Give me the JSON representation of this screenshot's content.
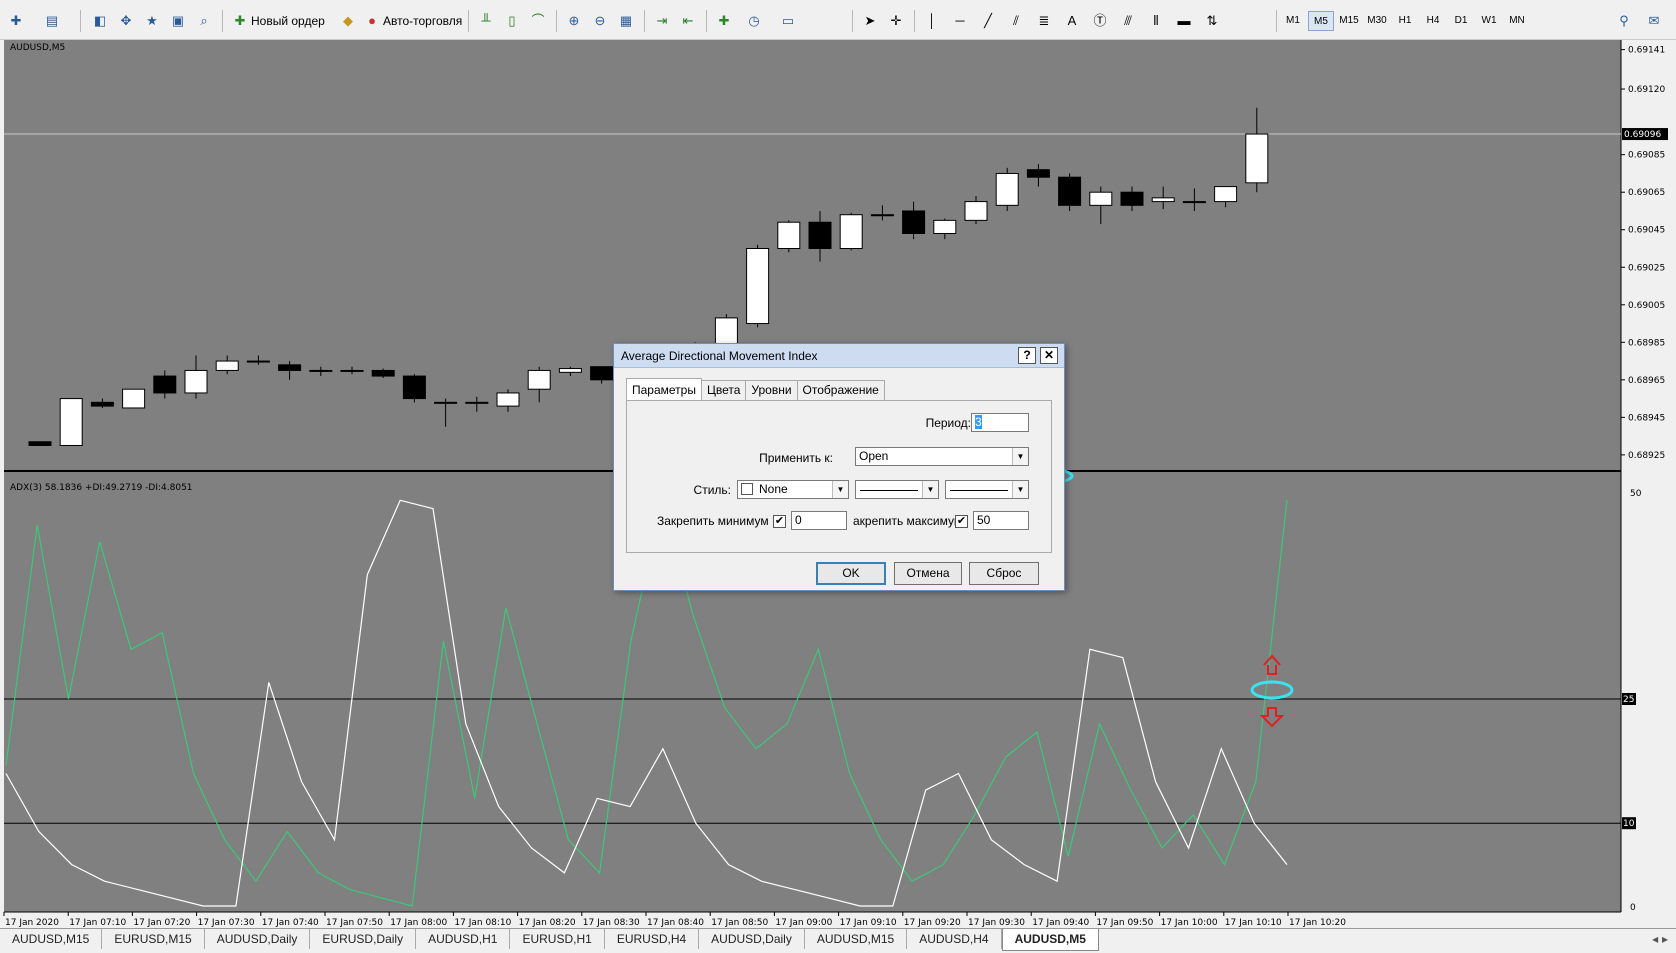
{
  "toolbar": {
    "new_order": "Новый ордер",
    "auto_trading": "Авто-торговля",
    "timeframes": [
      "M1",
      "M5",
      "M15",
      "M30",
      "H1",
      "H4",
      "D1",
      "W1",
      "MN"
    ],
    "active_timeframe": "M5"
  },
  "chart": {
    "symbol_label": "AUDUSD,M5",
    "price_ticks": [
      "0.69141",
      "0.69120",
      "0.69085",
      "0.69065",
      "0.69045",
      "0.69025",
      "0.69005",
      "0.68985",
      "0.68965",
      "0.68945",
      "0.68925"
    ],
    "current_price": "0.69096",
    "indicator_label": "ADX(3) 58.1836 +DI:49.2719 -DI:4.8051",
    "indicator_ticks": [
      "50",
      "25",
      "10",
      "0"
    ],
    "time_labels": [
      "17 Jan 2020",
      "17 Jan 07:10",
      "17 Jan 07:20",
      "17 Jan 07:30",
      "17 Jan 07:40",
      "17 Jan 07:50",
      "17 Jan 08:00",
      "17 Jan 08:10",
      "17 Jan 08:20",
      "17 Jan 08:30",
      "17 Jan 08:40",
      "17 Jan 08:50",
      "17 Jan 09:00",
      "17 Jan 09:10",
      "17 Jan 09:20",
      "17 Jan 09:30",
      "17 Jan 09:40",
      "17 Jan 09:50",
      "17 Jan 10:00",
      "17 Jan 10:10",
      "17 Jan 10:20"
    ],
    "colors": {
      "background": "#808080",
      "bull": "#ffffff",
      "bear": "#000000",
      "adx": "#ffffff",
      "plus_di": "#3cc878",
      "level": "#000000",
      "annotation_circle": "#39e4f0",
      "annotation_arrow": "#e02020"
    }
  },
  "chart_data": {
    "type": "candlestick",
    "candles": [
      [
        0.68932,
        0.68932,
        0.6893,
        0.6893
      ],
      [
        0.6893,
        0.68955,
        0.6893,
        0.68955
      ],
      [
        0.68953,
        0.68955,
        0.6895,
        0.68951
      ],
      [
        0.6895,
        0.6896,
        0.6895,
        0.6896
      ],
      [
        0.68967,
        0.6897,
        0.68955,
        0.68958
      ],
      [
        0.68958,
        0.68978,
        0.68955,
        0.6897
      ],
      [
        0.6897,
        0.68978,
        0.68968,
        0.68975
      ],
      [
        0.68975,
        0.68978,
        0.68973,
        0.68975
      ],
      [
        0.68973,
        0.68975,
        0.68965,
        0.6897
      ],
      [
        0.6897,
        0.68972,
        0.68967,
        0.6897
      ],
      [
        0.6897,
        0.68972,
        0.68968,
        0.6897
      ],
      [
        0.6897,
        0.68971,
        0.68966,
        0.68967
      ],
      [
        0.68967,
        0.68968,
        0.68953,
        0.68955
      ],
      [
        0.68953,
        0.68955,
        0.6894,
        0.68953
      ],
      [
        0.68953,
        0.68956,
        0.68948,
        0.68953
      ],
      [
        0.68951,
        0.6896,
        0.68948,
        0.68958
      ],
      [
        0.6896,
        0.68972,
        0.68953,
        0.6897
      ],
      [
        0.68969,
        0.68972,
        0.68967,
        0.68971
      ],
      [
        0.68972,
        0.68972,
        0.68963,
        0.68965
      ],
      [
        0.68967,
        0.6897,
        0.68962,
        0.68968
      ],
      [
        0.68968,
        0.68975,
        0.6896,
        0.6897
      ],
      [
        0.6897,
        0.68985,
        0.68965,
        0.68982
      ],
      [
        0.68982,
        0.69,
        0.68978,
        0.68998
      ],
      [
        0.68995,
        0.69037,
        0.68993,
        0.69035
      ],
      [
        0.69035,
        0.6905,
        0.69033,
        0.69049
      ],
      [
        0.69049,
        0.69055,
        0.69028,
        0.69035
      ],
      [
        0.69035,
        0.69054,
        0.69034,
        0.69053
      ],
      [
        0.69053,
        0.69058,
        0.6905,
        0.69053
      ],
      [
        0.69055,
        0.6906,
        0.6904,
        0.69043
      ],
      [
        0.69043,
        0.69051,
        0.6904,
        0.6905
      ],
      [
        0.6905,
        0.69063,
        0.69048,
        0.6906
      ],
      [
        0.69058,
        0.69078,
        0.69055,
        0.69075
      ],
      [
        0.69077,
        0.6908,
        0.69068,
        0.69073
      ],
      [
        0.69073,
        0.69075,
        0.69055,
        0.69058
      ],
      [
        0.69058,
        0.69068,
        0.69048,
        0.69065
      ],
      [
        0.69065,
        0.69068,
        0.69055,
        0.69058
      ],
      [
        0.6906,
        0.69068,
        0.69056,
        0.69062
      ],
      [
        0.6906,
        0.69067,
        0.69055,
        0.6906
      ],
      [
        0.6906,
        0.69068,
        0.69057,
        0.69068
      ],
      [
        0.6907,
        0.6911,
        0.69065,
        0.69096
      ]
    ],
    "candle_format": [
      "open",
      "high",
      "low",
      "close"
    ],
    "ylim": [
      0.68918,
      0.69144
    ],
    "indicator": {
      "name": "ADX(3)",
      "ylim": [
        0,
        50
      ],
      "levels": [
        25,
        10
      ],
      "series": [
        {
          "label": "+DI",
          "values": [
            17,
            46,
            25,
            44,
            31,
            33,
            16,
            8,
            3,
            9,
            4,
            2,
            1,
            0,
            32,
            13,
            36,
            22,
            8,
            4,
            32,
            49,
            35,
            24,
            19,
            22,
            31,
            16,
            8,
            3,
            5,
            11,
            18,
            21,
            6,
            22,
            14,
            7,
            11,
            5,
            15,
            49
          ]
        },
        {
          "label": "ADX",
          "values": [
            16,
            9,
            5,
            3,
            2,
            1,
            0,
            0,
            27,
            15,
            8,
            40,
            49,
            48,
            22,
            12,
            7,
            4,
            13,
            12,
            19,
            10,
            5,
            3,
            2,
            1,
            0,
            0,
            14,
            16,
            8,
            5,
            3,
            31,
            30,
            15,
            7,
            19,
            10,
            5
          ]
        }
      ]
    }
  },
  "dialog": {
    "title": "Average Directional Movement Index",
    "help": "?",
    "close": "✕",
    "tabs": [
      "Параметры",
      "Цвета",
      "Уровни",
      "Отображение"
    ],
    "active_tab": "Параметры",
    "period_label": "Период:",
    "period_value": "3",
    "apply_label": "Применить к:",
    "apply_value": "Open",
    "style_label": "Стиль:",
    "style_value": "None",
    "fix_min_label": "Закрепить минимум",
    "fix_min_value": "0",
    "fix_max_label": "акрепить максимум",
    "fix_max_value": "50",
    "ok": "OK",
    "cancel": "Отмена",
    "reset": "Сброс"
  },
  "tabs": [
    "AUDUSD,M15",
    "EURUSD,M15",
    "AUDUSD,Daily",
    "EURUSD,Daily",
    "AUDUSD,H1",
    "EURUSD,H1",
    "EURUSD,H4",
    "AUDUSD,Daily",
    "AUDUSD,M15",
    "AUDUSD,H4",
    "AUDUSD,M5"
  ],
  "active_tab": "AUDUSD,M5"
}
